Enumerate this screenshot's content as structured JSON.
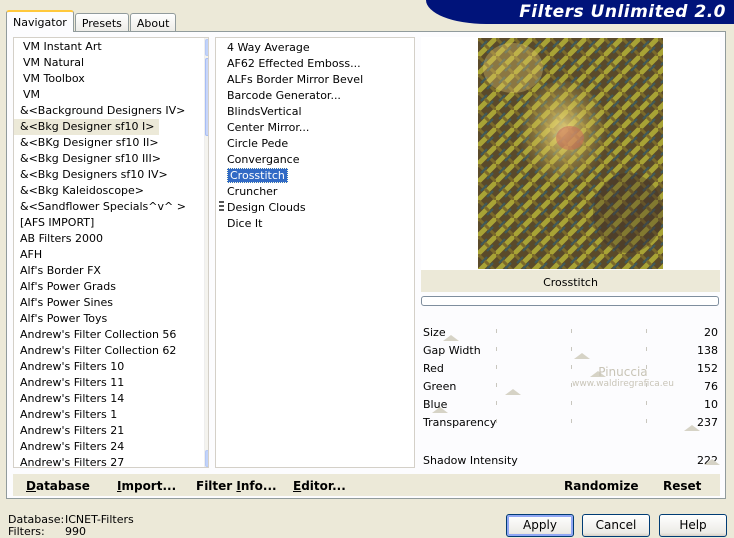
{
  "tabs": [
    {
      "label": "Navigator",
      "active": true
    },
    {
      "label": "Presets",
      "active": false
    },
    {
      "label": "About",
      "active": false
    }
  ],
  "banner": {
    "title": "Filters Unlimited 2.0",
    "color": "#00137a"
  },
  "categories": [
    "VM Instant Art",
    "VM Natural",
    "VM Toolbox",
    "VM",
    "&<Background Designers IV>",
    "&<Bkg Designer sf10 I>",
    "&<BKg Designer sf10 II>",
    "&<Bkg Designer sf10 III>",
    "&<Bkg Designers sf10 IV>",
    "&<Bkg Kaleidoscope>",
    "&<Sandflower Specials^v^ >",
    "[AFS IMPORT]",
    "AB Filters 2000",
    "AFH",
    "Alf's Border FX",
    "Alf's Power Grads",
    "Alf's Power Sines",
    "Alf's Power Toys",
    "Andrew's Filter Collection 56",
    "Andrew's Filter Collection 62",
    "Andrew's Filters 10",
    "Andrew's Filters 11",
    "Andrew's Filters 14",
    "Andrew's Filters 1",
    "Andrew's Filters 21",
    "Andrew's Filters 24",
    "Andrew's Filters 27"
  ],
  "selected_category_index": 5,
  "filters": [
    "4 Way Average",
    "AF62 Effected Emboss...",
    "ALFs Border Mirror Bevel",
    "Barcode Generator...",
    "BlindsVertical",
    "Center Mirror...",
    "Circle Pede",
    "Convergance",
    "Crosstitch",
    "Cruncher",
    "Design Clouds",
    "Dice It"
  ],
  "selected_filter_index": 8,
  "preview": {
    "filter_name": "Crosstitch",
    "progress": 0
  },
  "params": [
    {
      "label": "Size",
      "value": "20"
    },
    {
      "label": "Gap Width",
      "value": "138"
    },
    {
      "label": "Red",
      "value": "152"
    },
    {
      "label": "Green",
      "value": "76"
    },
    {
      "label": "Blue",
      "value": "10"
    },
    {
      "label": "Transparency",
      "value": "237"
    }
  ],
  "shadow": {
    "label": "Shadow Intensity",
    "value": "222"
  },
  "watermark": {
    "name": "Pinuccia",
    "site": "www.waldiregrafica.eu"
  },
  "bottom_links": {
    "database": {
      "u": "D",
      "rest": "atabase"
    },
    "import": {
      "u": "I",
      "rest": "mport..."
    },
    "filter_info": {
      "pre": "Filter ",
      "u": "I",
      "rest": "nfo..."
    },
    "editor": {
      "u": "E",
      "rest": "ditor..."
    },
    "randomize": "Randomize",
    "reset": "Reset"
  },
  "status": {
    "database_key": "Database:",
    "database_val": "ICNET-Filters",
    "filters_key": "Filters:",
    "filters_val": "990"
  },
  "buttons": {
    "apply": "Apply",
    "cancel": "Cancel",
    "help": "Help"
  }
}
